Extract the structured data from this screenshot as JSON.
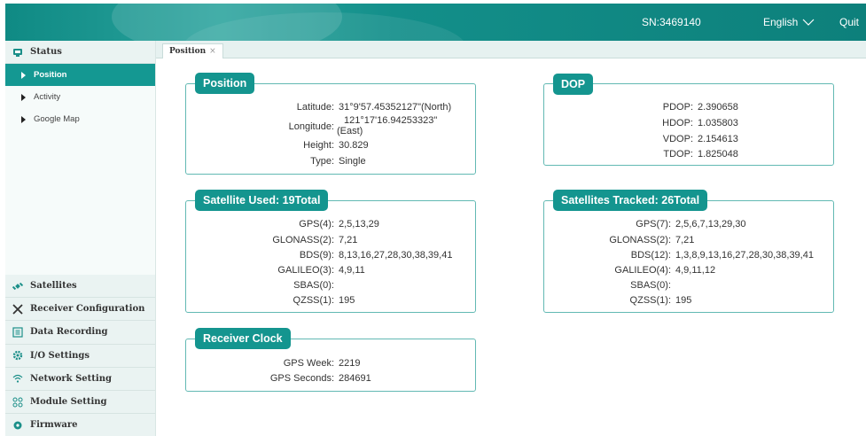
{
  "header": {
    "serial": "SN:3469140",
    "language": "English",
    "quit": "Quit"
  },
  "sidebar": {
    "status_label": "Status",
    "status_items": [
      {
        "label": "Position"
      },
      {
        "label": "Activity"
      },
      {
        "label": "Google Map"
      }
    ],
    "sections": [
      {
        "label": "Satellites",
        "icon": "satellite-icon"
      },
      {
        "label": "Receiver Configuration",
        "icon": "tools-icon"
      },
      {
        "label": "Data Recording",
        "icon": "recording-icon"
      },
      {
        "label": "I/O Settings",
        "icon": "gear-icon"
      },
      {
        "label": "Network Setting",
        "icon": "wifi-icon"
      },
      {
        "label": "Module Setting",
        "icon": "modules-icon"
      },
      {
        "label": "Firmware",
        "icon": "firmware-icon"
      }
    ]
  },
  "tabs": [
    {
      "label": "Position",
      "close": "×"
    }
  ],
  "position": {
    "title": "Position",
    "latitude_label": "Latitude:",
    "latitude": "31°9'57.45352127\"(North)",
    "longitude_label": "Longitude:",
    "longitude_line1": "121°17'16.94253323\"",
    "longitude_line2": "(East)",
    "height_label": "Height:",
    "height": "30.829",
    "type_label": "Type:",
    "type": "Single"
  },
  "dop": {
    "title": "DOP",
    "rows": [
      {
        "label": "PDOP:",
        "value": "2.390658"
      },
      {
        "label": "HDOP:",
        "value": "1.035803"
      },
      {
        "label": "VDOP:",
        "value": "2.154613"
      },
      {
        "label": "TDOP:",
        "value": "1.825048"
      }
    ]
  },
  "satellite_used": {
    "title": "Satellite Used:  19Total",
    "rows": [
      {
        "label": "GPS(4):",
        "value": "2,5,13,29"
      },
      {
        "label": "GLONASS(2):",
        "value": "7,21"
      },
      {
        "label": "BDS(9):",
        "value": "8,13,16,27,28,30,38,39,41"
      },
      {
        "label": "GALILEO(3):",
        "value": "4,9,11"
      },
      {
        "label": "SBAS(0):",
        "value": ""
      },
      {
        "label": "QZSS(1):",
        "value": "195"
      }
    ]
  },
  "satellites_tracked": {
    "title": "Satellites Tracked:  26Total",
    "rows": [
      {
        "label": "GPS(7):",
        "value": "2,5,6,7,13,29,30"
      },
      {
        "label": "GLONASS(2):",
        "value": "7,21"
      },
      {
        "label": "BDS(12):",
        "value": "1,3,8,9,13,16,27,28,30,38,39,41"
      },
      {
        "label": "GALILEO(4):",
        "value": "4,9,11,12"
      },
      {
        "label": "SBAS(0):",
        "value": ""
      },
      {
        "label": "QZSS(1):",
        "value": "195"
      }
    ]
  },
  "receiver_clock": {
    "title": "Receiver Clock",
    "rows": [
      {
        "label": "GPS Week:",
        "value": "2219"
      },
      {
        "label": "GPS Seconds:",
        "value": "284691"
      }
    ]
  }
}
